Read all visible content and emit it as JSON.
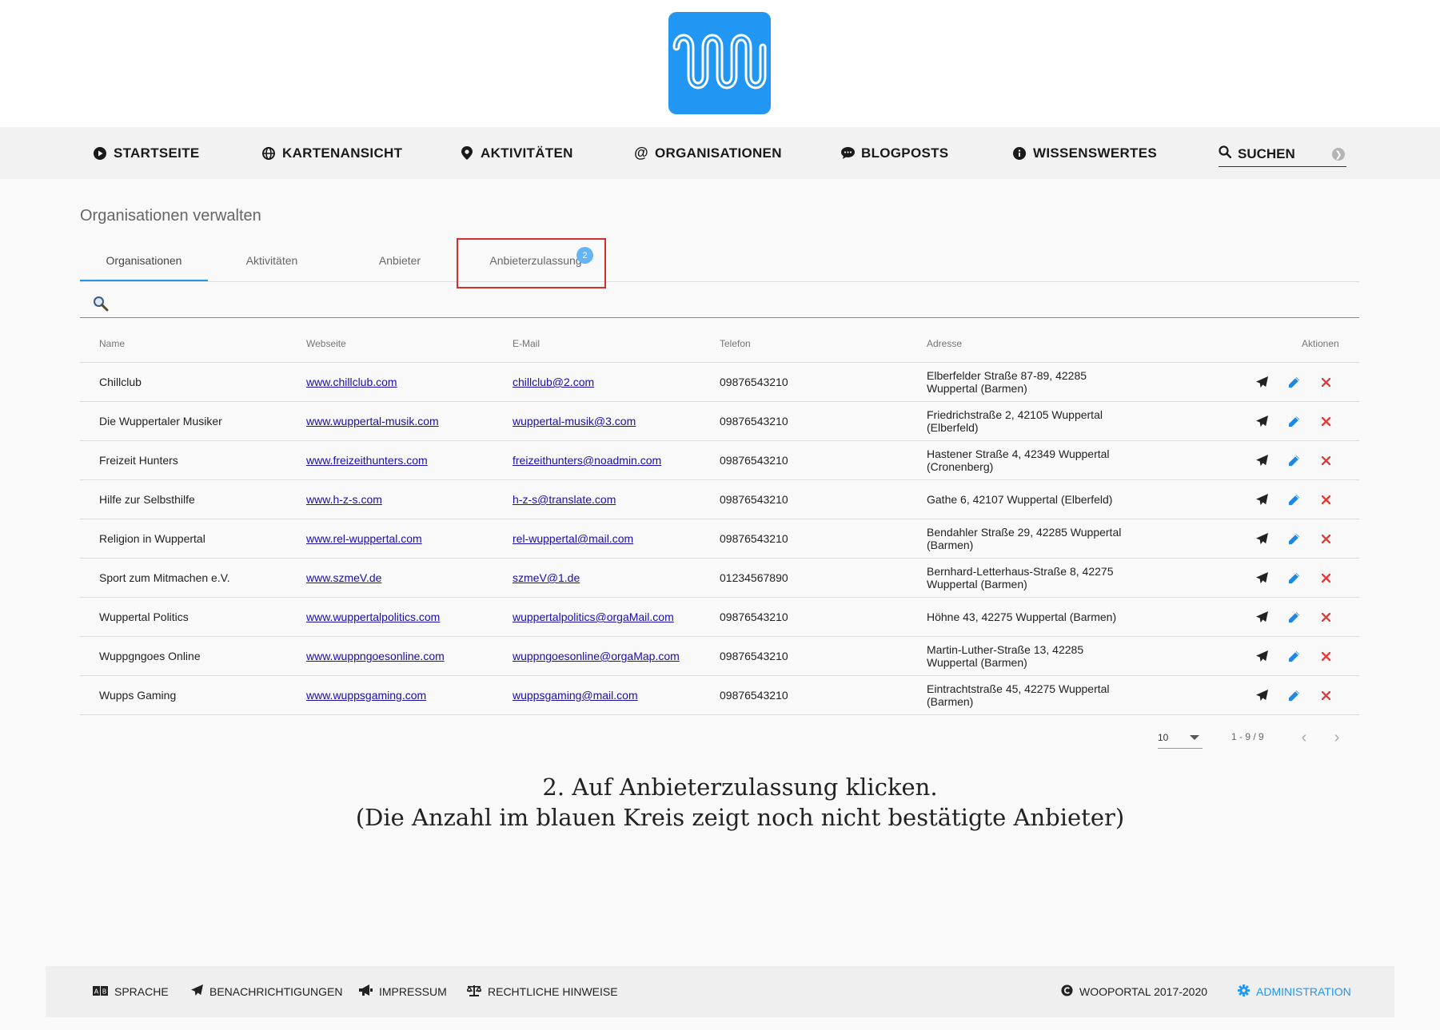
{
  "nav": {
    "items": [
      {
        "label": "STARTSEITE",
        "icon": "play-circle-icon"
      },
      {
        "label": "KARTENANSICHT",
        "icon": "globe-icon"
      },
      {
        "label": "AKTIVITÄTEN",
        "icon": "map-pin-icon"
      },
      {
        "label": "ORGANISATIONEN",
        "icon": "at-icon"
      },
      {
        "label": "BLOGPOSTS",
        "icon": "comment-icon"
      },
      {
        "label": "WISSENSWERTES",
        "icon": "info-circle-icon"
      }
    ],
    "search_label": "SUCHEN"
  },
  "page": {
    "title": "Organisationen verwalten"
  },
  "tabs": [
    {
      "label": "Organisationen",
      "active": true
    },
    {
      "label": "Aktivitäten",
      "active": false
    },
    {
      "label": "Anbieter",
      "active": false
    },
    {
      "label": "Anbieterzulassung",
      "active": false,
      "badge": "2"
    }
  ],
  "table": {
    "headers": [
      "Name",
      "Webseite",
      "E-Mail",
      "Telefon",
      "Adresse",
      "Aktionen"
    ],
    "rows": [
      {
        "name": "Chillclub",
        "website": "www.chillclub.com",
        "email": "chillclub@2.com",
        "phone": "09876543210",
        "address": "Elberfelder Straße 87-89, 42285 Wuppertal (Barmen)"
      },
      {
        "name": "Die Wuppertaler Musiker",
        "website": "www.wuppertal-musik.com",
        "email": "wuppertal-musik@3.com",
        "phone": "09876543210",
        "address": "Friedrichstraße 2, 42105 Wuppertal (Elberfeld)"
      },
      {
        "name": "Freizeit Hunters",
        "website": "www.freizeithunters.com",
        "email": "freizeithunters@noadmin.com",
        "phone": "09876543210",
        "address": "Hastener Straße 4, 42349 Wuppertal (Cronenberg)"
      },
      {
        "name": "Hilfe zur Selbsthilfe",
        "website": "www.h-z-s.com",
        "email": "h-z-s@translate.com",
        "phone": "09876543210",
        "address": "Gathe 6, 42107 Wuppertal (Elberfeld)"
      },
      {
        "name": "Religion in Wuppertal",
        "website": "www.rel-wuppertal.com",
        "email": "rel-wuppertal@mail.com",
        "phone": "09876543210",
        "address": "Bendahler Straße 29, 42285 Wuppertal (Barmen)"
      },
      {
        "name": "Sport zum Mitmachen e.V.",
        "website": "www.szmeV.de",
        "email": "szmeV@1.de",
        "phone": "01234567890",
        "address": "Bernhard-Letterhaus-Straße 8, 42275 Wuppertal (Barmen)"
      },
      {
        "name": "Wuppertal Politics",
        "website": "www.wuppertalpolitics.com",
        "email": "wuppertalpolitics@orgaMail.com",
        "phone": "09876543210",
        "address": "Höhne 43, 42275 Wuppertal (Barmen)"
      },
      {
        "name": "Wuppgngoes Online",
        "website": "www.wuppngoesonline.com",
        "email": "wuppngoesonline@orgaMap.com",
        "phone": "09876543210",
        "address": "Martin-Luther-Straße 13, 42285 Wuppertal (Barmen)"
      },
      {
        "name": "Wupps Gaming",
        "website": "www.wuppsgaming.com",
        "email": "wuppsgaming@mail.com",
        "phone": "09876543210",
        "address": "Eintrachtstraße 45, 42275 Wuppertal (Barmen)"
      }
    ]
  },
  "pagination": {
    "page_size": "10",
    "range": "1 - 9 / 9"
  },
  "caption": {
    "line1": "2. Auf Anbieterzulassung klicken.",
    "line2": "(Die Anzahl im blauen Kreis zeigt noch nicht bestätigte Anbieter)"
  },
  "footer": {
    "items": [
      {
        "label": "SPRACHE",
        "icon": "language-icon"
      },
      {
        "label": "BENACHRICHTIGUNGEN",
        "icon": "paper-plane-icon"
      },
      {
        "label": "IMPRESSUM",
        "icon": "megaphone-icon"
      },
      {
        "label": "RECHTLICHE HINWEISE",
        "icon": "scale-icon"
      }
    ],
    "copyright": "WOOPORTAL 2017-2020",
    "admin": "ADMINISTRATION"
  },
  "colors": {
    "accent": "#2196f3",
    "highlight": "#d32f2f",
    "delete": "#e53935"
  }
}
